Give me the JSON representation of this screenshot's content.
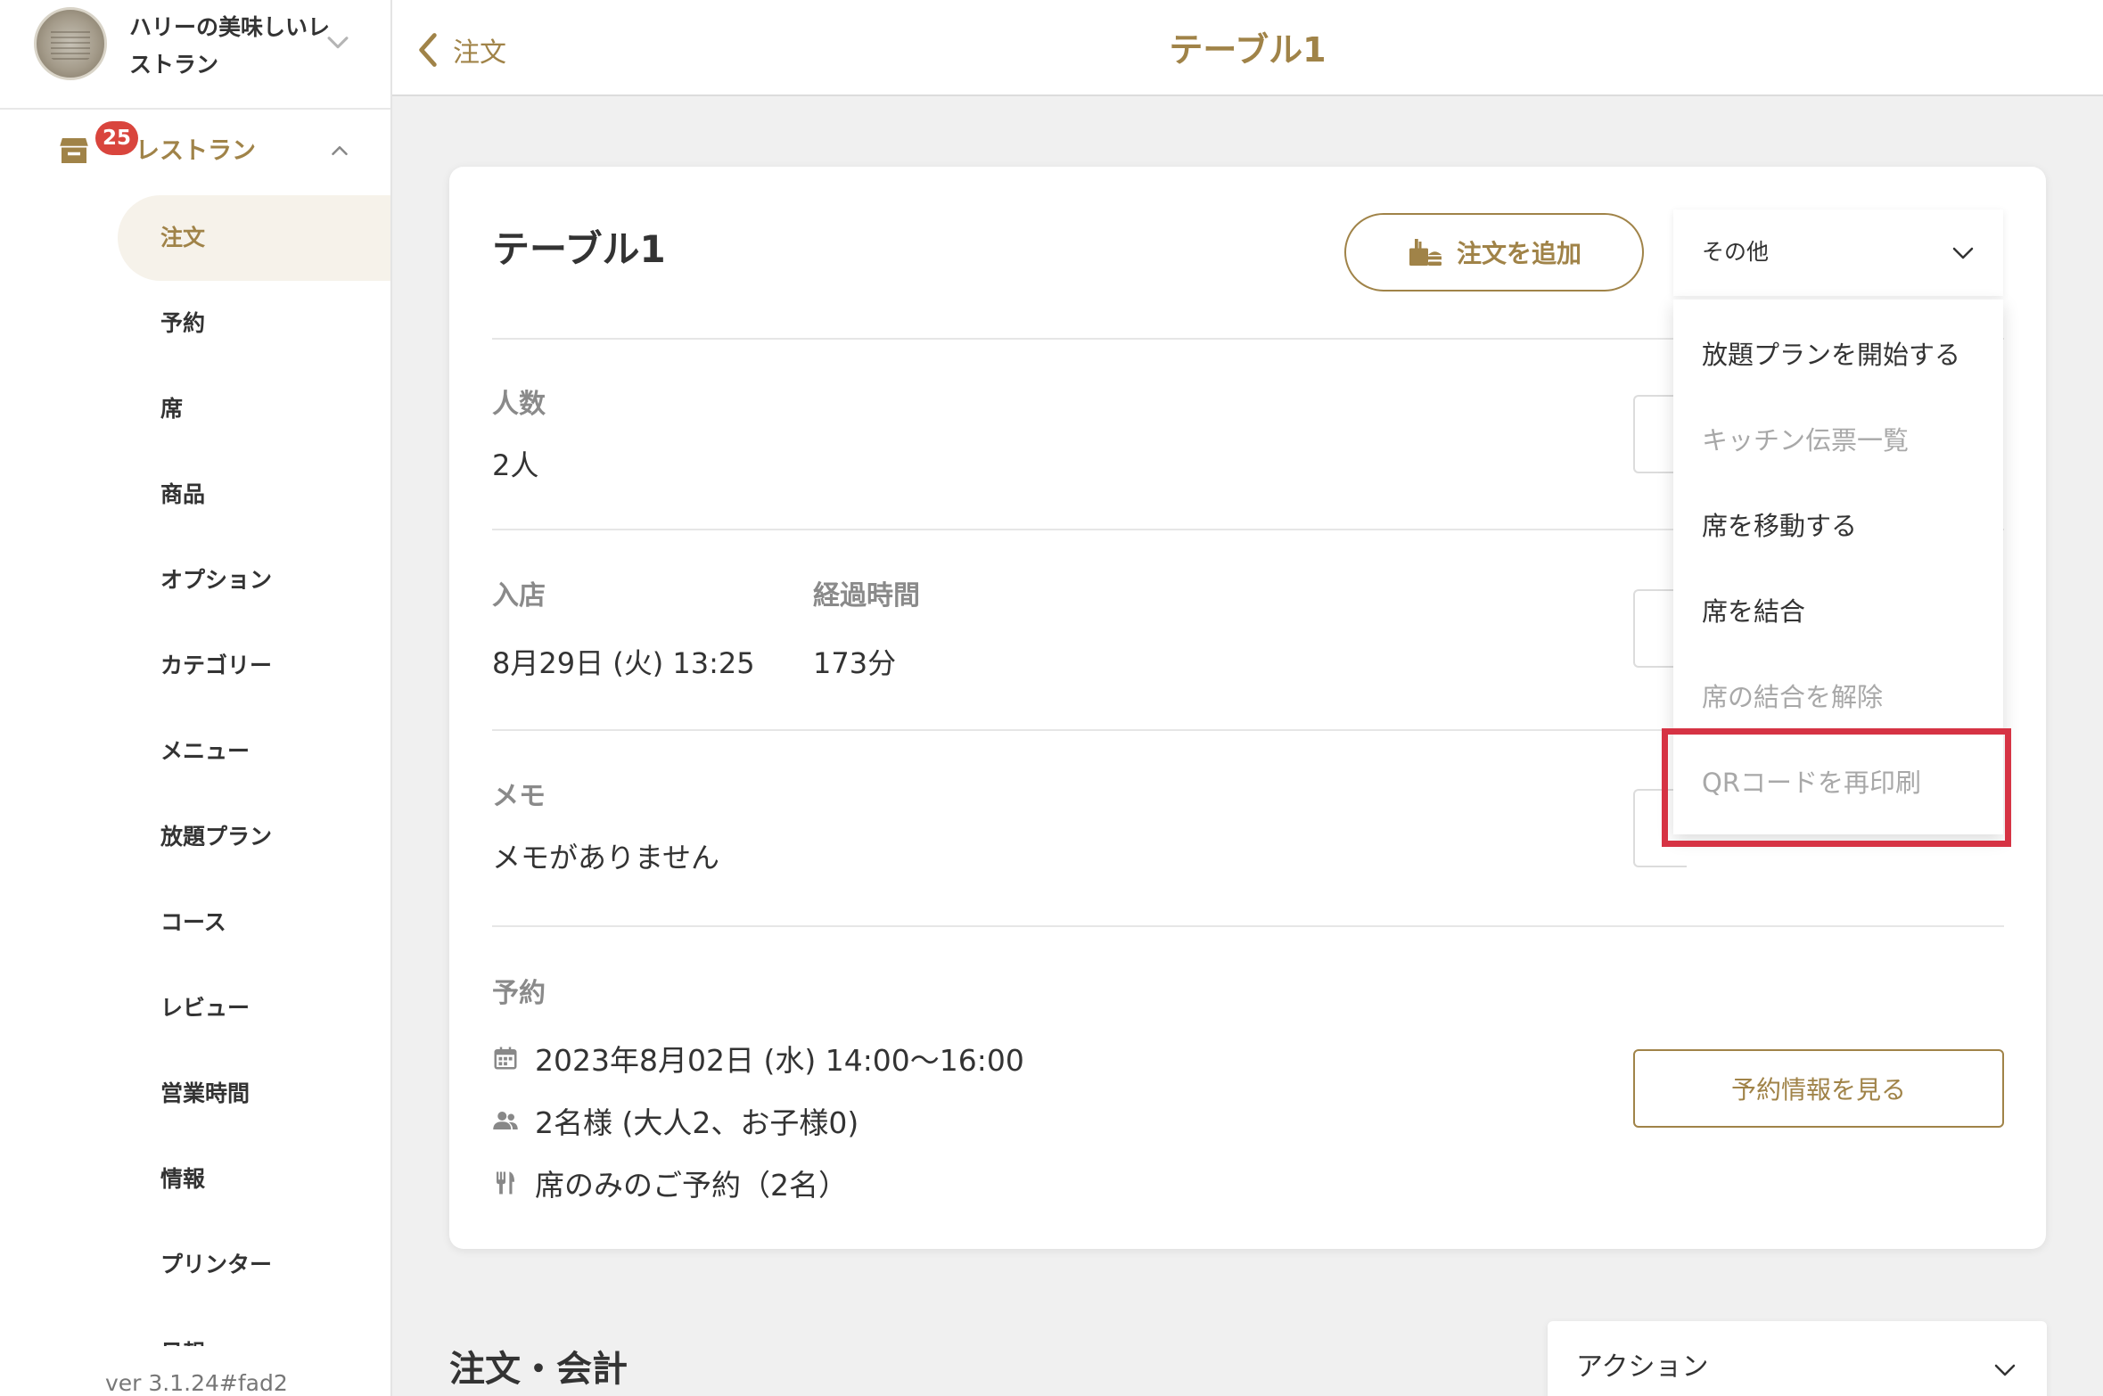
{
  "sidebar": {
    "shop_name": "ハリーの美味しいレストラン",
    "group": {
      "label": "レストラン",
      "badge": "25"
    },
    "items": [
      {
        "label": "注文",
        "active": true
      },
      {
        "label": "予約"
      },
      {
        "label": "席"
      },
      {
        "label": "商品"
      },
      {
        "label": "オプション"
      },
      {
        "label": "カテゴリー"
      },
      {
        "label": "メニュー"
      },
      {
        "label": "放題プラン"
      },
      {
        "label": "コース"
      },
      {
        "label": "レビュー"
      },
      {
        "label": "営業時間"
      },
      {
        "label": "情報"
      },
      {
        "label": "プリンター"
      },
      {
        "label": "日報"
      }
    ],
    "version": "ver 3.1.24#fad2"
  },
  "topbar": {
    "back_label": "注文",
    "title": "テーブル1"
  },
  "card": {
    "title": "テーブル1",
    "add_order_label": "注文を追加",
    "guests": {
      "label": "人数",
      "value": "2人"
    },
    "checkin": {
      "label": "入店",
      "value": "8月29日 (火) 13:25"
    },
    "elapsed": {
      "label": "経過時間",
      "value": "173分"
    },
    "memo": {
      "label": "メモ",
      "value": "メモがありません"
    },
    "reservation": {
      "label": "予約",
      "datetime": "2023年8月02日 (水) 14:00～16:00",
      "people": "2名様 (大人2、お子様0)",
      "plan": "席のみのご予約（2名）",
      "view_button": "予約情報を見る"
    }
  },
  "dropdown": {
    "toggle_label": "その他",
    "items": [
      {
        "label": "放題プランを開始する",
        "disabled": false
      },
      {
        "label": "キッチン伝票一覧",
        "disabled": true
      },
      {
        "label": "席を移動する",
        "disabled": false
      },
      {
        "label": "席を結合",
        "disabled": false
      },
      {
        "label": "席の結合を解除",
        "disabled": true
      },
      {
        "label": "QRコードを再印刷",
        "disabled": true
      }
    ]
  },
  "orders_section": {
    "title": "注文・会計",
    "action_label": "アクション"
  },
  "colors": {
    "accent": "#a08348",
    "badge": "#d9453d",
    "highlight": "#d63344",
    "active_bg": "#f6f2ea"
  }
}
